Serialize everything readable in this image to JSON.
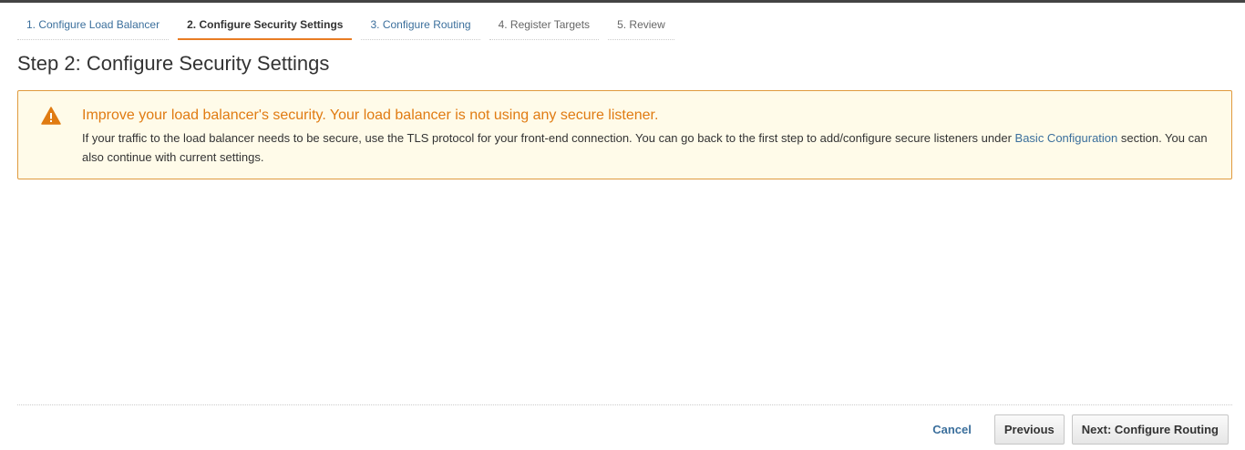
{
  "wizard": {
    "tabs": [
      {
        "label": "1. Configure Load Balancer"
      },
      {
        "label": "2. Configure Security Settings"
      },
      {
        "label": "3. Configure Routing"
      },
      {
        "label": "4. Register Targets"
      },
      {
        "label": "5. Review"
      }
    ],
    "active_tab": "2. Configure Security Settings"
  },
  "page": {
    "title": "Step 2: Configure Security Settings"
  },
  "alert": {
    "icon": "warning-icon",
    "title": "Improve your load balancer's security. Your load balancer is not using any secure listener.",
    "body_before_link": "If your traffic to the load balancer needs to be secure, use the TLS protocol for your front-end connection. You can go back to the first step to add/configure secure listeners under ",
    "link_text": "Basic Configuration",
    "body_after_link": " section. You can also continue with current settings."
  },
  "footer": {
    "cancel_label": "Cancel",
    "previous_label": "Previous",
    "next_label": "Next: Configure Routing"
  },
  "colors": {
    "accent_orange": "#e87c23",
    "warning_text": "#e07b12",
    "link_blue": "#3b6f9c",
    "alert_background": "#fffbe9",
    "alert_border": "#e09a3e"
  }
}
